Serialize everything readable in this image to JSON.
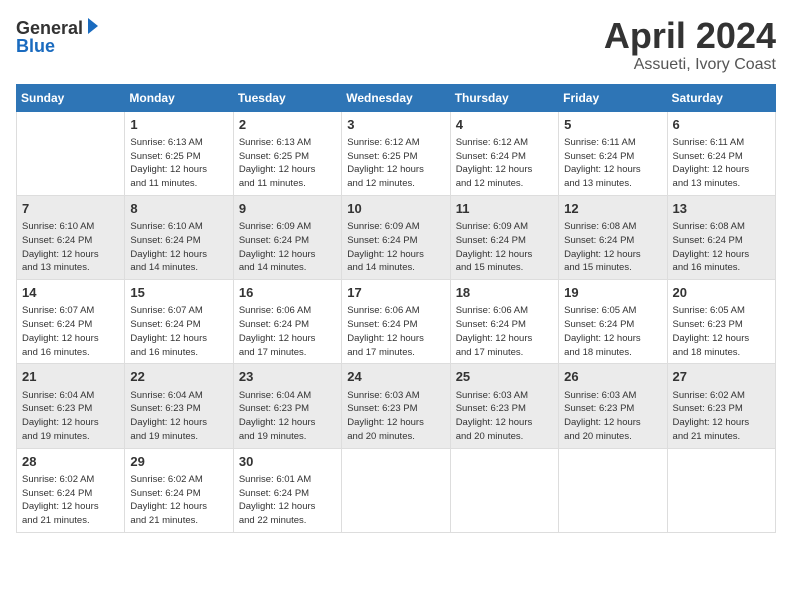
{
  "header": {
    "logo_general": "General",
    "logo_blue": "Blue",
    "month": "April 2024",
    "location": "Assueti, Ivory Coast"
  },
  "days_of_week": [
    "Sunday",
    "Monday",
    "Tuesday",
    "Wednesday",
    "Thursday",
    "Friday",
    "Saturday"
  ],
  "weeks": [
    [
      {
        "day": "",
        "info": ""
      },
      {
        "day": "1",
        "info": "Sunrise: 6:13 AM\nSunset: 6:25 PM\nDaylight: 12 hours\nand 11 minutes."
      },
      {
        "day": "2",
        "info": "Sunrise: 6:13 AM\nSunset: 6:25 PM\nDaylight: 12 hours\nand 11 minutes."
      },
      {
        "day": "3",
        "info": "Sunrise: 6:12 AM\nSunset: 6:25 PM\nDaylight: 12 hours\nand 12 minutes."
      },
      {
        "day": "4",
        "info": "Sunrise: 6:12 AM\nSunset: 6:24 PM\nDaylight: 12 hours\nand 12 minutes."
      },
      {
        "day": "5",
        "info": "Sunrise: 6:11 AM\nSunset: 6:24 PM\nDaylight: 12 hours\nand 13 minutes."
      },
      {
        "day": "6",
        "info": "Sunrise: 6:11 AM\nSunset: 6:24 PM\nDaylight: 12 hours\nand 13 minutes."
      }
    ],
    [
      {
        "day": "7",
        "info": "Sunrise: 6:10 AM\nSunset: 6:24 PM\nDaylight: 12 hours\nand 13 minutes."
      },
      {
        "day": "8",
        "info": "Sunrise: 6:10 AM\nSunset: 6:24 PM\nDaylight: 12 hours\nand 14 minutes."
      },
      {
        "day": "9",
        "info": "Sunrise: 6:09 AM\nSunset: 6:24 PM\nDaylight: 12 hours\nand 14 minutes."
      },
      {
        "day": "10",
        "info": "Sunrise: 6:09 AM\nSunset: 6:24 PM\nDaylight: 12 hours\nand 14 minutes."
      },
      {
        "day": "11",
        "info": "Sunrise: 6:09 AM\nSunset: 6:24 PM\nDaylight: 12 hours\nand 15 minutes."
      },
      {
        "day": "12",
        "info": "Sunrise: 6:08 AM\nSunset: 6:24 PM\nDaylight: 12 hours\nand 15 minutes."
      },
      {
        "day": "13",
        "info": "Sunrise: 6:08 AM\nSunset: 6:24 PM\nDaylight: 12 hours\nand 16 minutes."
      }
    ],
    [
      {
        "day": "14",
        "info": "Sunrise: 6:07 AM\nSunset: 6:24 PM\nDaylight: 12 hours\nand 16 minutes."
      },
      {
        "day": "15",
        "info": "Sunrise: 6:07 AM\nSunset: 6:24 PM\nDaylight: 12 hours\nand 16 minutes."
      },
      {
        "day": "16",
        "info": "Sunrise: 6:06 AM\nSunset: 6:24 PM\nDaylight: 12 hours\nand 17 minutes."
      },
      {
        "day": "17",
        "info": "Sunrise: 6:06 AM\nSunset: 6:24 PM\nDaylight: 12 hours\nand 17 minutes."
      },
      {
        "day": "18",
        "info": "Sunrise: 6:06 AM\nSunset: 6:24 PM\nDaylight: 12 hours\nand 17 minutes."
      },
      {
        "day": "19",
        "info": "Sunrise: 6:05 AM\nSunset: 6:24 PM\nDaylight: 12 hours\nand 18 minutes."
      },
      {
        "day": "20",
        "info": "Sunrise: 6:05 AM\nSunset: 6:23 PM\nDaylight: 12 hours\nand 18 minutes."
      }
    ],
    [
      {
        "day": "21",
        "info": "Sunrise: 6:04 AM\nSunset: 6:23 PM\nDaylight: 12 hours\nand 19 minutes."
      },
      {
        "day": "22",
        "info": "Sunrise: 6:04 AM\nSunset: 6:23 PM\nDaylight: 12 hours\nand 19 minutes."
      },
      {
        "day": "23",
        "info": "Sunrise: 6:04 AM\nSunset: 6:23 PM\nDaylight: 12 hours\nand 19 minutes."
      },
      {
        "day": "24",
        "info": "Sunrise: 6:03 AM\nSunset: 6:23 PM\nDaylight: 12 hours\nand 20 minutes."
      },
      {
        "day": "25",
        "info": "Sunrise: 6:03 AM\nSunset: 6:23 PM\nDaylight: 12 hours\nand 20 minutes."
      },
      {
        "day": "26",
        "info": "Sunrise: 6:03 AM\nSunset: 6:23 PM\nDaylight: 12 hours\nand 20 minutes."
      },
      {
        "day": "27",
        "info": "Sunrise: 6:02 AM\nSunset: 6:23 PM\nDaylight: 12 hours\nand 21 minutes."
      }
    ],
    [
      {
        "day": "28",
        "info": "Sunrise: 6:02 AM\nSunset: 6:24 PM\nDaylight: 12 hours\nand 21 minutes."
      },
      {
        "day": "29",
        "info": "Sunrise: 6:02 AM\nSunset: 6:24 PM\nDaylight: 12 hours\nand 21 minutes."
      },
      {
        "day": "30",
        "info": "Sunrise: 6:01 AM\nSunset: 6:24 PM\nDaylight: 12 hours\nand 22 minutes."
      },
      {
        "day": "",
        "info": ""
      },
      {
        "day": "",
        "info": ""
      },
      {
        "day": "",
        "info": ""
      },
      {
        "day": "",
        "info": ""
      }
    ]
  ]
}
